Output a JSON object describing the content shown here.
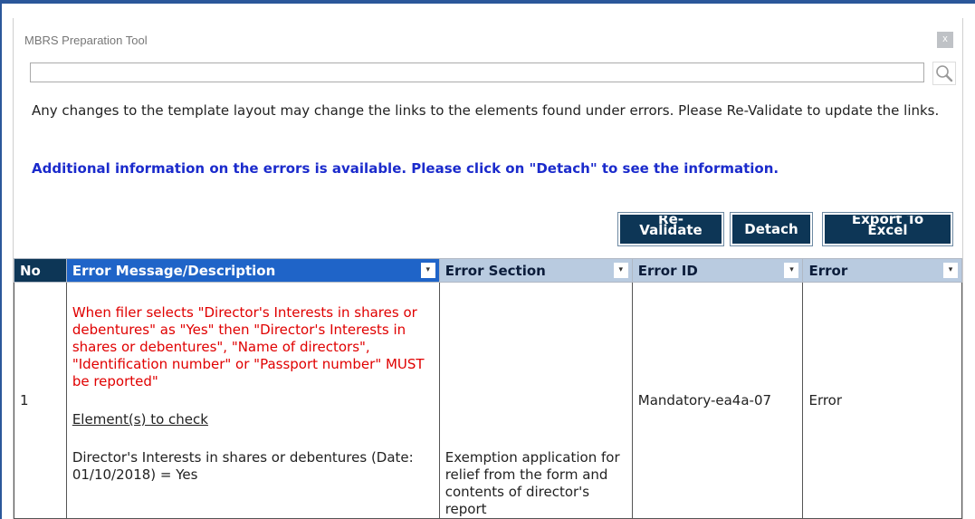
{
  "window": {
    "title": "MBRS Preparation Tool",
    "close_label": "x"
  },
  "search": {
    "value": "",
    "placeholder": ""
  },
  "messages": {
    "layout_notice": "Any changes to the template layout may change the links to the elements found under errors. Please Re-Validate to update the links.",
    "detach_notice": "Additional information on the errors is available. Please click on \"Detach\" to see the information."
  },
  "toolbar": {
    "revalidate_line1": "Re-",
    "revalidate_line2": "Validate",
    "detach_label": "Detach",
    "export_line1": "Export To",
    "export_line2": "Excel"
  },
  "table": {
    "columns": [
      "No",
      "Error Message/Description",
      "Error Section",
      "Error ID",
      "Error"
    ],
    "rows": [
      {
        "no": "1",
        "message": "When filer selects \"Director's Interests in shares or debentures\" as \"Yes\" then \"Director's Interests in shares or debentures\", \"Name of directors\", \"Identification number\" or \"Passport number\" MUST be reported\"",
        "elements_heading": "Element(s) to check",
        "element_value": "Director's Interests in shares or debentures (Date: 01/10/2018) = Yes",
        "section": "Exemption application for relief from the form and contents of director's report",
        "error_id": "Mandatory-ea4a-07",
        "error": "Error"
      }
    ]
  },
  "colors": {
    "accent": "#1f64c8",
    "header_dark": "#0d3656",
    "error_text": "#e00000",
    "link_text": "#1b2bcc"
  },
  "icons": [
    "search-icon",
    "close-icon",
    "dropdown-icon"
  ]
}
